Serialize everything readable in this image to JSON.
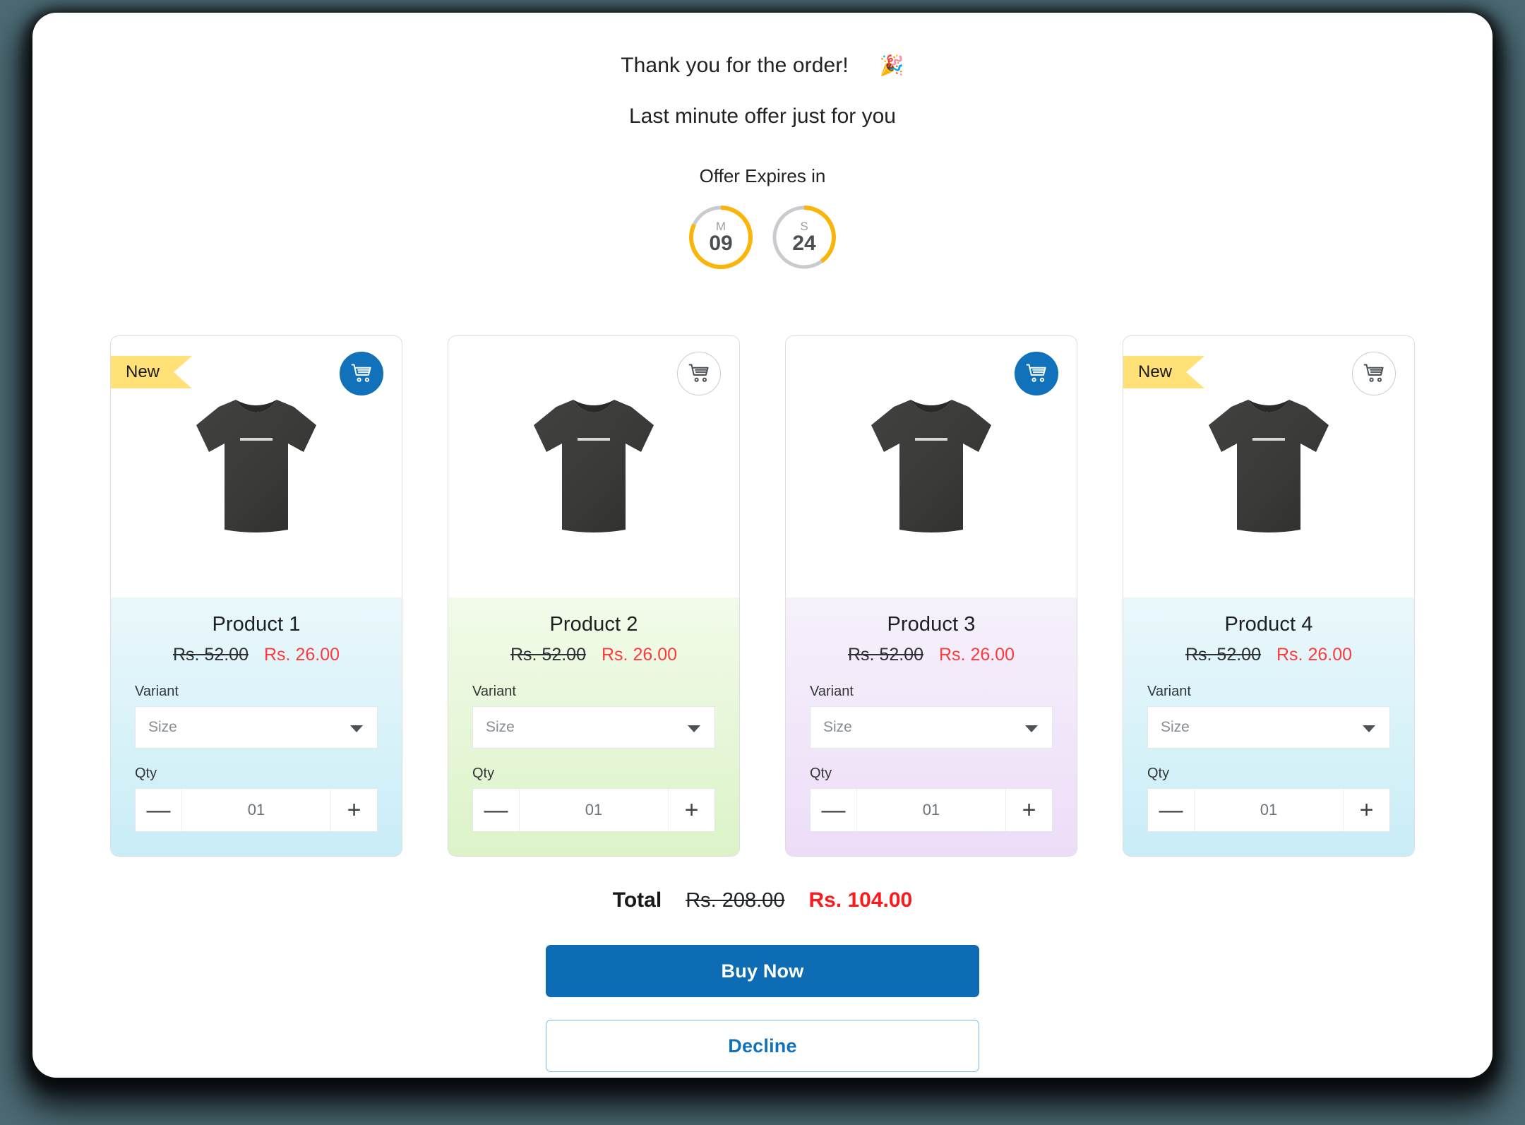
{
  "header": {
    "thank_you": "Thank you for the order!",
    "emoji": "🎉",
    "emoji_name": "party-popper-emoji",
    "subheading": "Last minute offer just for you"
  },
  "timer": {
    "label": "Offer Expires in",
    "units": [
      {
        "letter": "M",
        "value": "09",
        "progress_percent": 82
      },
      {
        "letter": "S",
        "value": "24",
        "progress_percent": 40
      }
    ],
    "track_color": "#c8cccf",
    "progress_color": "#f9b50b"
  },
  "products": [
    {
      "name": "Product 1",
      "badge": "New",
      "has_badge": true,
      "cart_selected": true,
      "price_old": "Rs. 52.00",
      "price_new": "Rs. 26.00",
      "variant_label": "Variant",
      "variant_value": "Size",
      "qty_label": "Qty",
      "qty_value": "01",
      "minus": "—",
      "plus": "+",
      "tint": "blue"
    },
    {
      "name": "Product 2",
      "badge": "",
      "has_badge": false,
      "cart_selected": false,
      "price_old": "Rs. 52.00",
      "price_new": "Rs. 26.00",
      "variant_label": "Variant",
      "variant_value": "Size",
      "qty_label": "Qty",
      "qty_value": "01",
      "minus": "—",
      "plus": "+",
      "tint": "green"
    },
    {
      "name": "Product 3",
      "badge": "",
      "has_badge": false,
      "cart_selected": true,
      "price_old": "Rs. 52.00",
      "price_new": "Rs. 26.00",
      "variant_label": "Variant",
      "variant_value": "Size",
      "qty_label": "Qty",
      "qty_value": "01",
      "minus": "—",
      "plus": "+",
      "tint": "purple"
    },
    {
      "name": "Product 4",
      "badge": "New",
      "has_badge": true,
      "cart_selected": false,
      "price_old": "Rs. 52.00",
      "price_new": "Rs. 26.00",
      "variant_label": "Variant",
      "variant_value": "Size",
      "qty_label": "Qty",
      "qty_value": "01",
      "minus": "—",
      "plus": "+",
      "tint": "blue"
    }
  ],
  "total": {
    "label": "Total",
    "old": "Rs. 208.00",
    "new": "Rs. 104.00"
  },
  "actions": {
    "buy_now": "Buy Now",
    "decline": "Decline"
  },
  "colors": {
    "primary_blue": "#0d6cb4",
    "cart_blue": "#1171bb",
    "sale_red": "#fb3b3b",
    "total_red": "#fa1c1c",
    "badge_yellow": "#ffe177",
    "timer_amber": "#f9b50b",
    "page_backdrop": "#4d6b75"
  }
}
